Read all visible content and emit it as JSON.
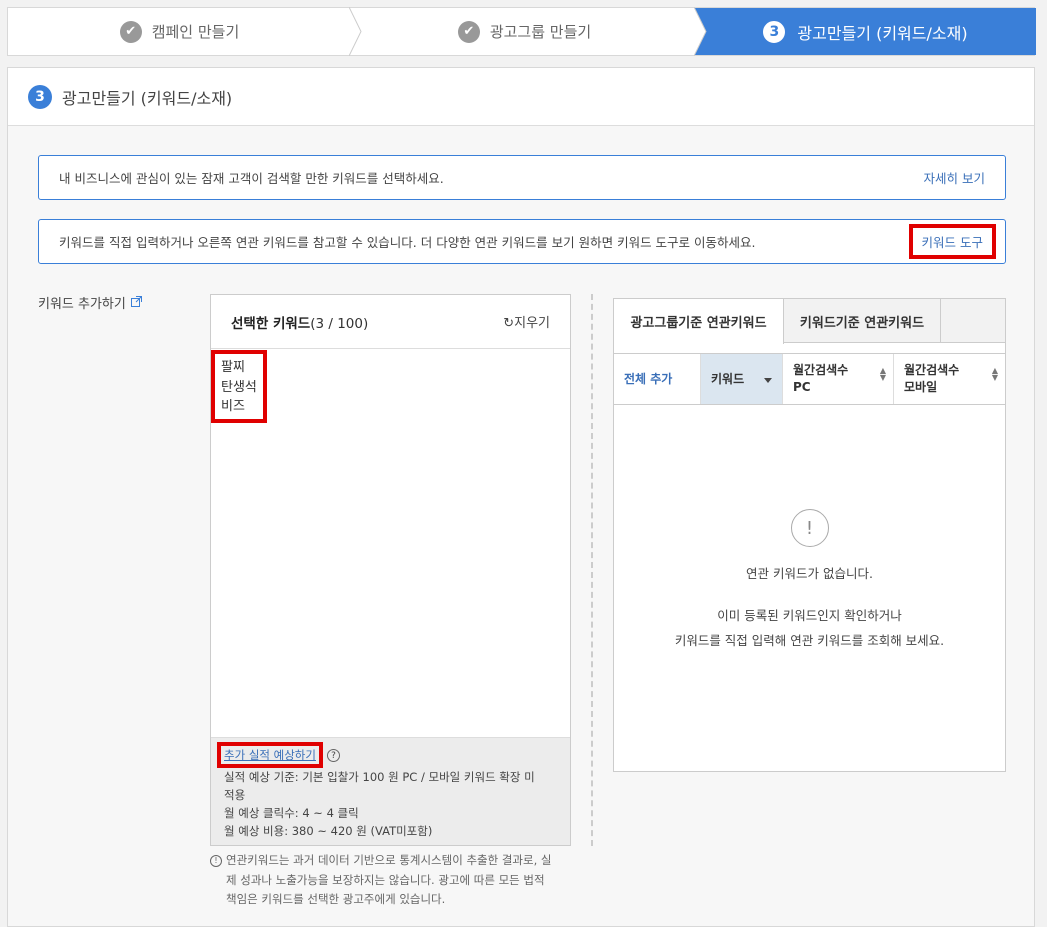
{
  "steps": {
    "step1": "캠페인 만들기",
    "step2": "광고그룹 만들기",
    "step3_num": "3",
    "step3": "광고만들기 (키워드/소재)"
  },
  "panel": {
    "num": "3",
    "title": "광고만들기 (키워드/소재)"
  },
  "notice1": {
    "text": "내 비즈니스에 관심이 있는 잠재 고객이 검색할 만한 키워드를 선택하세요.",
    "link": "자세히 보기"
  },
  "notice2": {
    "text": "키워드를 직접 입력하거나 오른쪽 연관 키워드를 참고할 수 있습니다. 더 다양한 연관 키워드를 보기 원하면 키워드 도구로 이동하세요.",
    "link": "키워드 도구"
  },
  "keyword_add": {
    "label": "키워드 추가하기",
    "ext_icon": "external-link-icon"
  },
  "selected": {
    "title_bold": "선택한 키워드",
    "count": "(3 / 100)",
    "clear_label": "지우기",
    "keywords": [
      "팔찌",
      "탄생석",
      "비즈"
    ],
    "forecast_link": "추가 실적 예상하기",
    "forecast_lines": [
      "실적 예상 기준:  기본 입찰가 100 원 PC / 모바일 키워드 확장 미",
      "적용",
      "월 예상 클릭수: 4 ~ 4  클릭",
      "월 예상 비용: 380 ~ 420  원 (VAT미포함)"
    ]
  },
  "disclaimer": {
    "line1": "연관키워드는 과거 데이터 기반으로 통계시스템이 추출한 결과로, 실",
    "line2": "제 성과나 노출가능을 보장하지는 않습니다. 광고에 따른 모든 법적",
    "line3": "책임은 키워드를 선택한 광고주에게 있습니다."
  },
  "related": {
    "tab1": "광고그룹기준 연관키워드",
    "tab2": "키워드기준 연관키워드",
    "col_all": "전체 추가",
    "col_kw": "키워드",
    "col_pc_1": "월간검색수",
    "col_pc_2": "PC",
    "col_mo_1": "월간검색수",
    "col_mo_2": "모바일",
    "empty_title": "연관 키워드가 없습니다.",
    "empty_line1": "이미 등록된 키워드인지 확인하거나",
    "empty_line2": "키워드를 직접 입력해 연관 키워드를 조회해 보세요."
  },
  "colors": {
    "accent": "#3a7fd8",
    "highlight": "#e00000"
  }
}
